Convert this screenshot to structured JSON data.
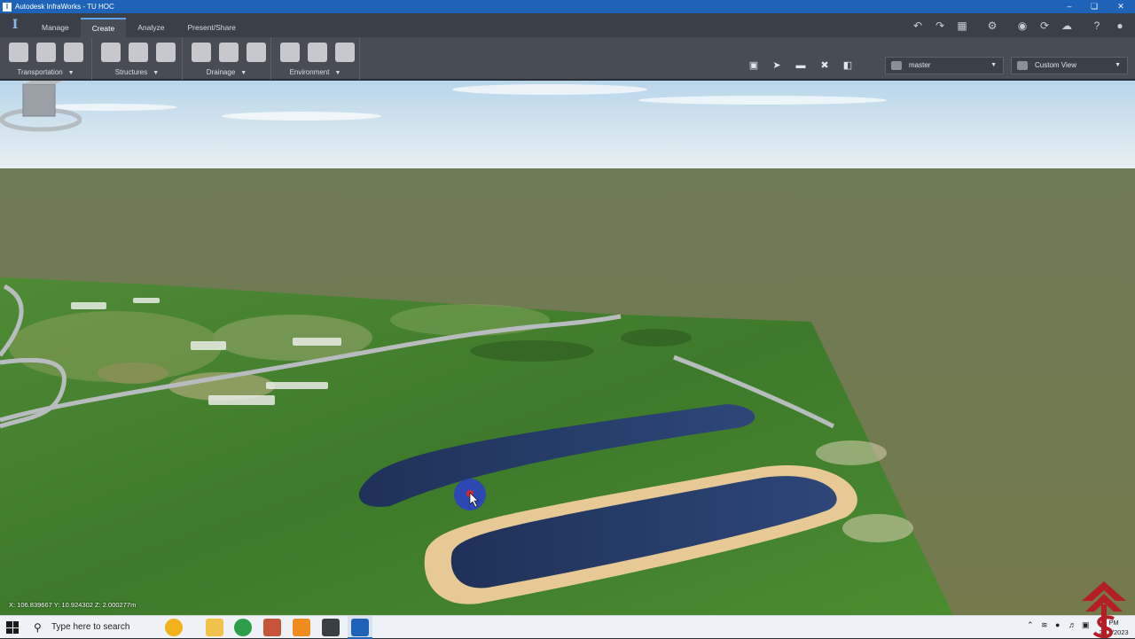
{
  "window": {
    "title": "Autodesk InfraWorks - TU HOC"
  },
  "tabs": [
    {
      "label": "Manage",
      "active": false
    },
    {
      "label": "Create",
      "active": true
    },
    {
      "label": "Analyze",
      "active": false
    },
    {
      "label": "Present/Share",
      "active": false
    }
  ],
  "ribbon": {
    "panels": [
      {
        "label": "Transportation",
        "icons": [
          "road-icon",
          "road-curve-icon",
          "component-road-icon"
        ]
      },
      {
        "label": "Structures",
        "icons": [
          "bridge-icon",
          "tunnel-icon",
          "building-icon"
        ]
      },
      {
        "label": "Drainage",
        "icons": [
          "culvert-icon",
          "pipe-icon",
          "pipe-connector-icon"
        ]
      },
      {
        "label": "Environment",
        "icons": [
          "traffic-light-icon",
          "city-furniture-icon",
          "tree-icon"
        ]
      }
    ],
    "proposal_select": "master",
    "view_select": "Custom View"
  },
  "viewport": {
    "coordinates": "X: 106.839667 Y: 10.924302 Z: 2.000277m"
  },
  "taskbar": {
    "search_placeholder": "Type here to search",
    "time": "PM",
    "date": "2/12/2023"
  },
  "colors": {
    "title_bar": "#1f63b8",
    "ribbon": "#474c55",
    "water": "#263a64",
    "sand": "#e6c994",
    "sky": "#cfe4f2",
    "grass": "#3f7a2a"
  }
}
